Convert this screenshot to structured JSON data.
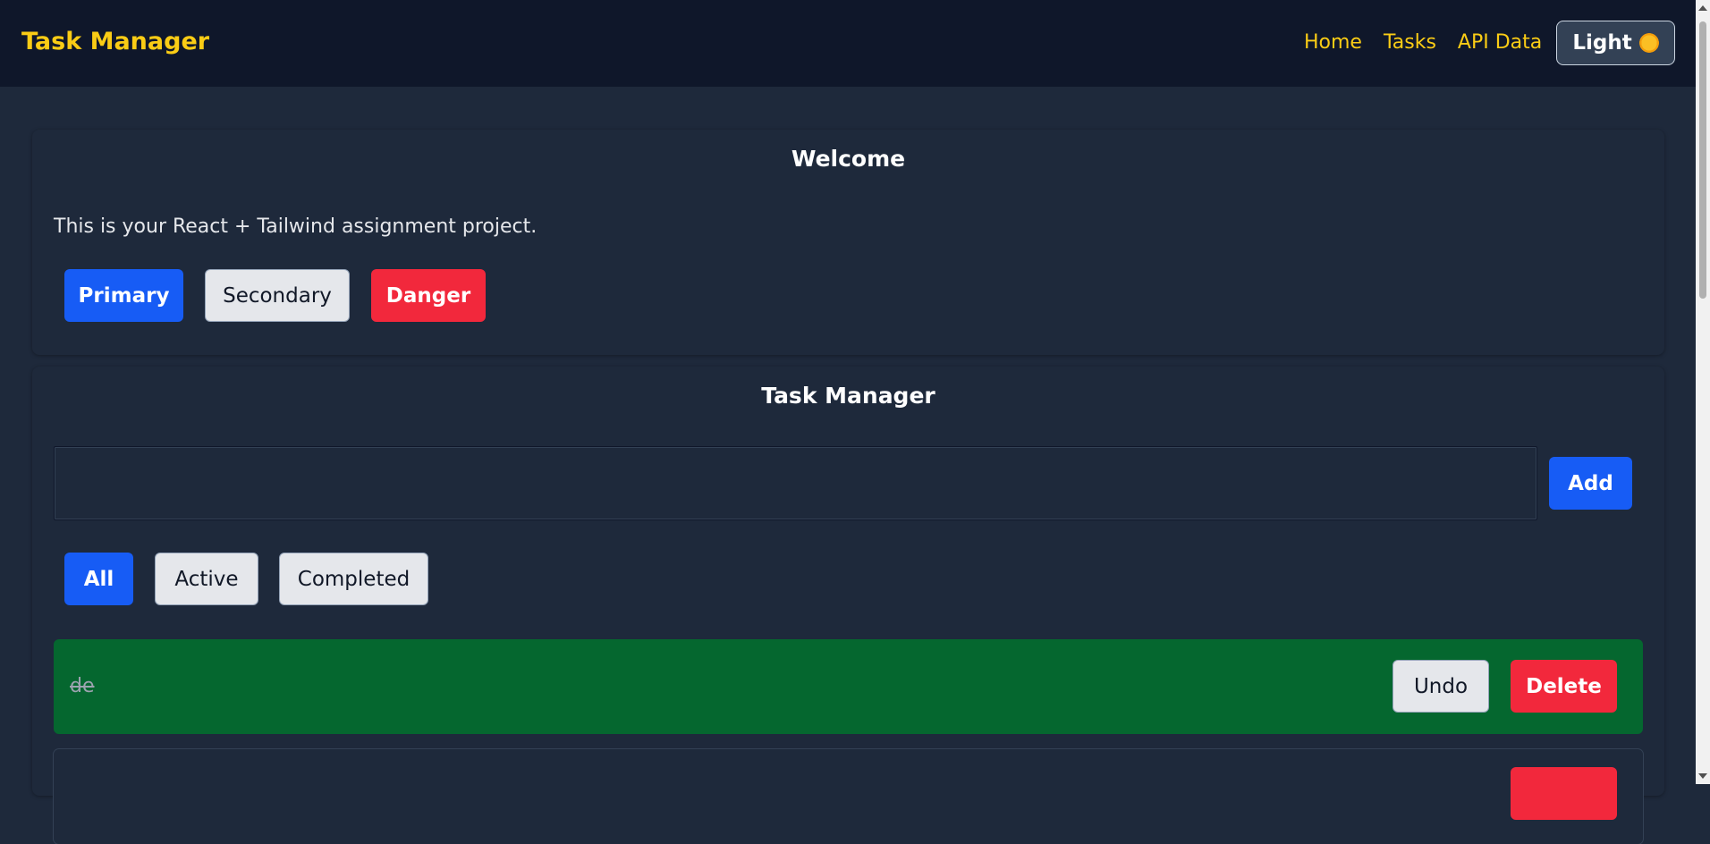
{
  "navbar": {
    "brand": "Task Manager",
    "links": [
      "Home",
      "Tasks",
      "API Data"
    ],
    "theme_label": "Light"
  },
  "welcome": {
    "title": "Welcome",
    "text": "This is your React + Tailwind assignment project.",
    "buttons": {
      "primary": "Primary",
      "secondary": "Secondary",
      "danger": "Danger"
    }
  },
  "task_manager": {
    "title": "Task Manager",
    "input_value": "",
    "add_label": "Add",
    "filters": [
      "All",
      "Active",
      "Completed"
    ],
    "tasks": [
      {
        "text": "de",
        "completed": true,
        "undo_label": "Undo",
        "delete_label": "Delete"
      },
      {
        "text": "",
        "completed": false,
        "delete_label": ""
      }
    ]
  },
  "colors": {
    "accent": "#facc15",
    "primary": "#175cf5",
    "danger": "#f2283c",
    "completed_bg": "#05672f",
    "page_bg": "#1e293b",
    "nav_bg": "#0f172a"
  }
}
